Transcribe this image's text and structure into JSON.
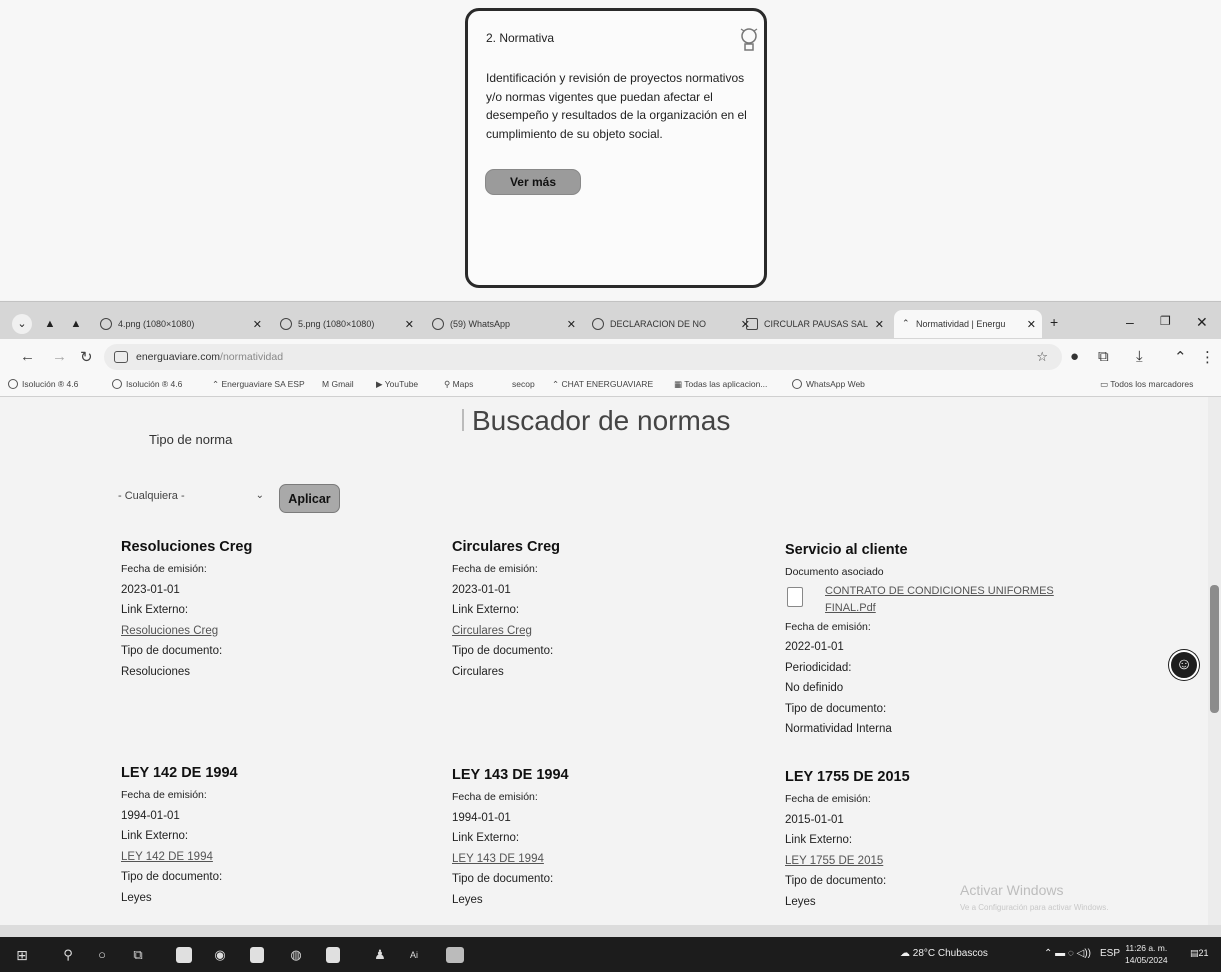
{
  "card": {
    "title": "2. Normativa",
    "description": "Identificación y revisión de proyectos normativos y/o normas vigentes que puedan afectar el desempeño y resultados de la organización en el cumplimiento de su objeto social.",
    "button": "Ver más"
  },
  "browser": {
    "tabs": [
      {
        "label": "4.png (1080×1080)",
        "icon": "globe-icon"
      },
      {
        "label": "5.png (1080×1080)",
        "icon": "globe-icon"
      },
      {
        "label": "(59) WhatsApp",
        "icon": "whatsapp-icon"
      },
      {
        "label": "DECLARACION DE NO",
        "icon": "globe-icon"
      },
      {
        "label": "CIRCULAR PAUSAS SAL",
        "icon": "gmail-icon"
      },
      {
        "label": "Normatividad | Energu",
        "icon": "site-icon"
      }
    ],
    "url_domain": "energuaviare.com",
    "url_path": "/normatividad",
    "bookmarks": [
      "Isolución ® 4.6",
      "Isolución ® 4.6",
      "Energuaviare SA ESP",
      "Gmail",
      "YouTube",
      "Maps",
      "secop",
      "CHAT ENERGUAVIARE",
      "Todas las aplicacion...",
      "WhatsApp Web"
    ],
    "all_bookmarks": "Todos los marcadores"
  },
  "page": {
    "title": "Buscador de normas",
    "filter_label": "Tipo de norma",
    "filter_value": "- Cualquiera -",
    "apply_button": "Aplicar"
  },
  "labels": {
    "fecha": "Fecha de emisión:",
    "link": "Link Externo:",
    "tipo": "Tipo de documento:",
    "doc_asociado": "Documento asociado",
    "periodicidad": "Periodicidad:"
  },
  "entries": [
    {
      "title": "Resoluciones Creg",
      "fecha": "2023-01-01",
      "link": "Resoluciones Creg",
      "tipo": "Resoluciones"
    },
    {
      "title": "Circulares Creg",
      "fecha": "2023-01-01",
      "link": "Circulares Creg",
      "tipo": "Circulares"
    },
    {
      "title": "Servicio al cliente",
      "doc_line1": "CONTRATO DE CONDICIONES UNIFORMES",
      "doc_line2": "FINAL.Pdf",
      "fecha": "2022-01-01",
      "periodicidad": "No definido",
      "tipo": "Normatividad Interna"
    },
    {
      "title": "LEY 142 DE 1994",
      "fecha": "1994-01-01",
      "link": "LEY 142 DE 1994",
      "tipo": "Leyes"
    },
    {
      "title": "LEY 143 DE 1994",
      "fecha": "1994-01-01",
      "link": "LEY 143 DE 1994",
      "tipo": "Leyes"
    },
    {
      "title": "LEY 1755 DE 2015",
      "fecha": "2015-01-01",
      "link": "LEY 1755 DE 2015",
      "tipo": "Leyes"
    }
  ],
  "watermark": {
    "title": "Activar Windows",
    "subtitle": "Ve a Configuración para activar Windows."
  },
  "taskbar": {
    "weather": "28°C  Chubascos",
    "lang": "ESP",
    "time": "11:26 a. m.",
    "date": "14/05/2024",
    "notifications": "21"
  }
}
